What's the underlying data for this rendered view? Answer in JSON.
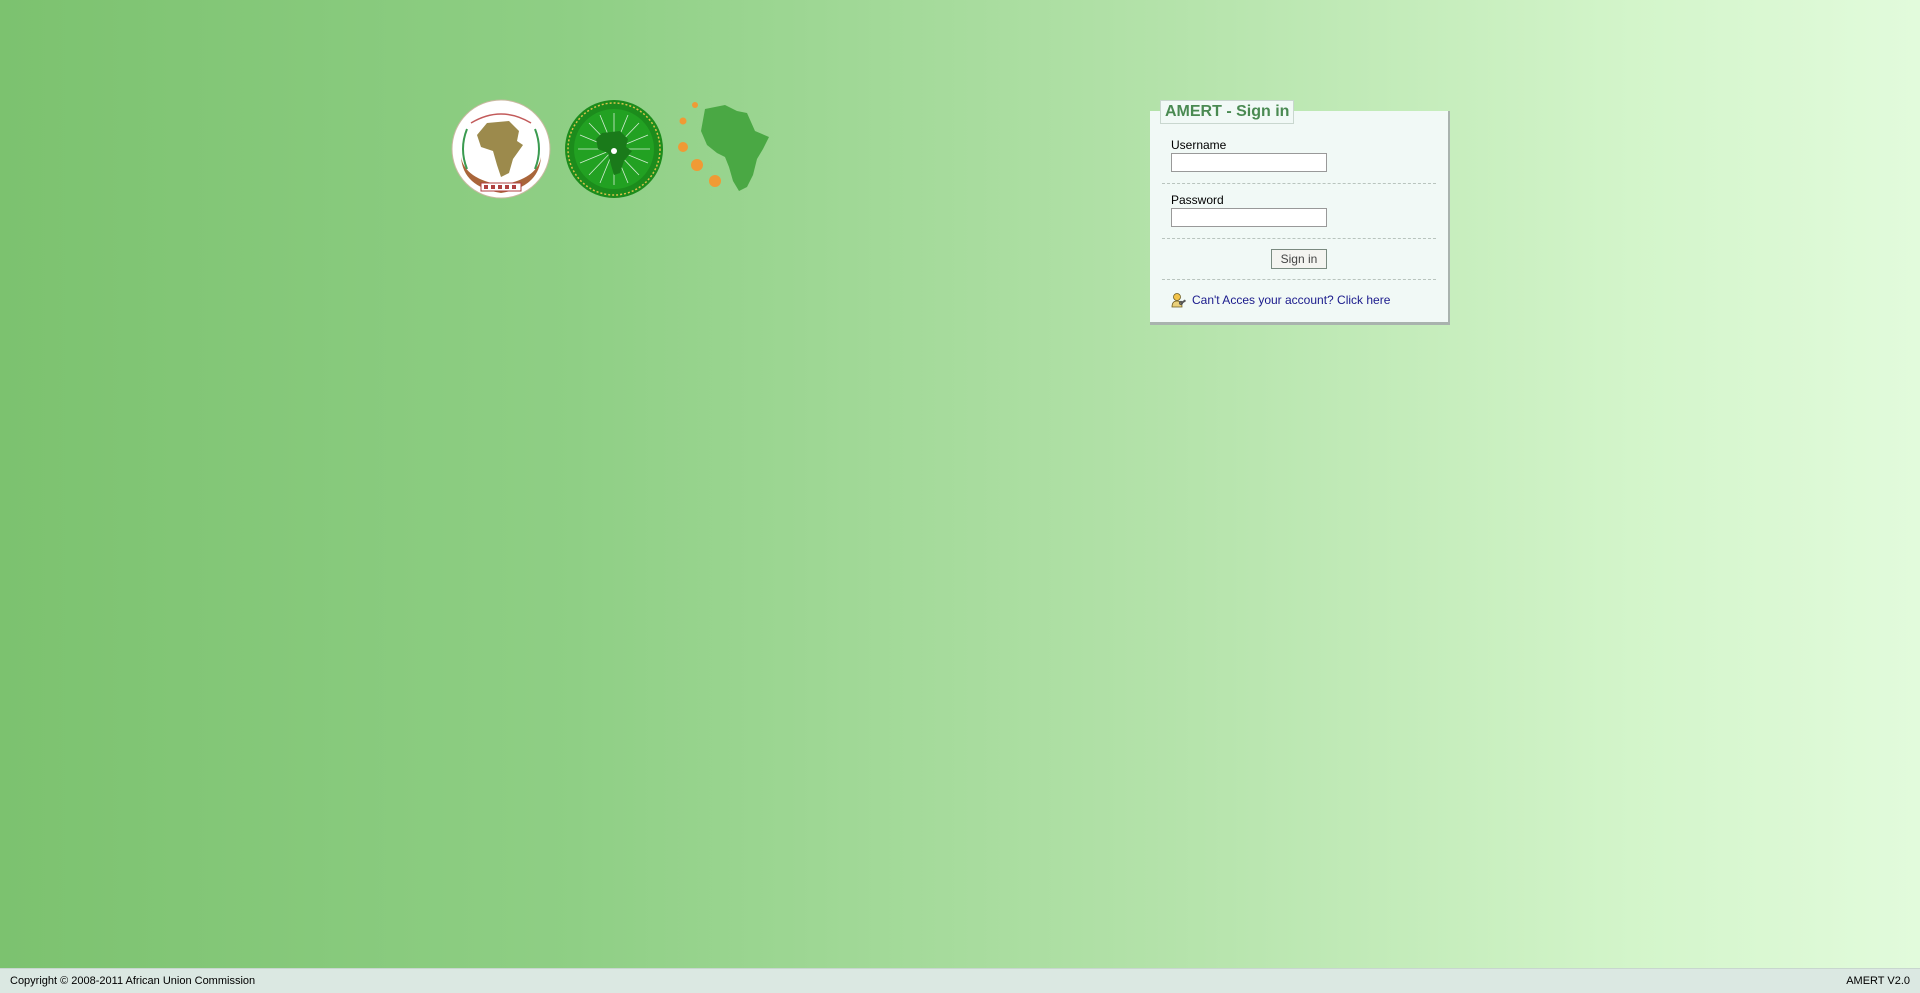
{
  "signin": {
    "title": "AMERT - Sign in",
    "username_label": "Username",
    "username_value": "",
    "password_label": "Password",
    "password_value": "",
    "submit_label": "Sign in",
    "help_icon": "key-user-icon",
    "help_link": "Can't Acces your account? Click here"
  },
  "logos": {
    "emblem": "african-union-emblem-icon",
    "seal": "african-union-seal-icon",
    "map": "africa-map-icon"
  },
  "footer": {
    "copyright": "Copyright © 2008-2011 African Union Commission",
    "version": "AMERT V2.0"
  },
  "colors": {
    "title": "#4a8a52",
    "link": "#1a1a8c",
    "panel": "#f1f9f6",
    "map": "#4aa844",
    "dots": "#f09a35",
    "seal": "#1c8c1c"
  }
}
